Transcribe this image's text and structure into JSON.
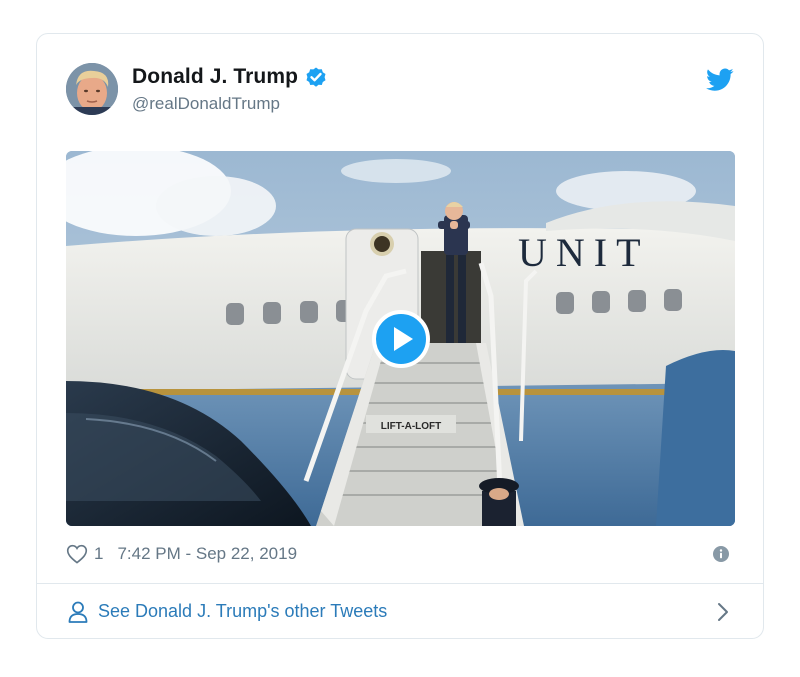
{
  "tweet": {
    "author": {
      "display_name": "Donald J. Trump",
      "handle": "@realDonaldTrump",
      "verified": true
    },
    "media": {
      "type": "video",
      "scene_text": {
        "fuselage": "UNIT",
        "stairs": "LIFT-A-LOFT"
      }
    },
    "likes": "1",
    "timestamp": "7:42 PM - Sep 22, 2019",
    "cta_label": "See Donald J. Trump's other Tweets"
  },
  "icons": {
    "brand": "twitter-bird-icon",
    "verified": "verified-badge-icon",
    "like": "heart-icon",
    "info": "info-icon",
    "profile": "person-icon",
    "next": "chevron-right-icon",
    "play": "play-icon"
  },
  "colors": {
    "accent": "#1da1f2",
    "link": "#2b7bb9",
    "text": "#14171a",
    "muted": "#657786",
    "border": "#e1e8ed"
  }
}
